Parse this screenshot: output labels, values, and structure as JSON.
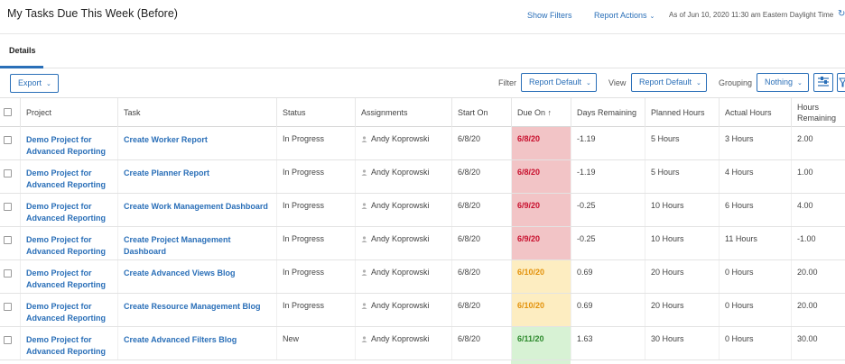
{
  "header": {
    "title": "My Tasks Due This Week (Before)",
    "show_filters": "Show Filters",
    "report_actions": "Report Actions",
    "as_of": "As of Jun 10, 2020 11:30 am Eastern Daylight Time"
  },
  "tabs": {
    "details": "Details"
  },
  "toolbar": {
    "export": "Export",
    "filter_label": "Filter",
    "filter_value": "Report Default",
    "view_label": "View",
    "view_value": "Report Default",
    "grouping_label": "Grouping",
    "grouping_value": "Nothing"
  },
  "table": {
    "columns": [
      "Project",
      "Task",
      "Status",
      "Assignments",
      "Start On",
      "Due On ↑",
      "Days Remaining",
      "Planned Hours",
      "Actual Hours",
      "Hours Remaining"
    ],
    "rows": [
      {
        "project": "Demo Project for Advanced Reporting",
        "task": "Create Worker Report",
        "status": "In Progress",
        "assignment": "Andy Koprowski",
        "start": "6/8/20",
        "due": "6/8/20",
        "due_status": "red",
        "days": "-1.19",
        "planned": "5 Hours",
        "actual": "3 Hours",
        "remaining": "2.00"
      },
      {
        "project": "Demo Project for Advanced Reporting",
        "task": "Create Planner Report",
        "status": "In Progress",
        "assignment": "Andy Koprowski",
        "start": "6/8/20",
        "due": "6/8/20",
        "due_status": "red",
        "days": "-1.19",
        "planned": "5 Hours",
        "actual": "4 Hours",
        "remaining": "1.00"
      },
      {
        "project": "Demo Project for Advanced Reporting",
        "task": "Create Work Management Dashboard",
        "status": "In Progress",
        "assignment": "Andy Koprowski",
        "start": "6/8/20",
        "due": "6/9/20",
        "due_status": "red",
        "days": "-0.25",
        "planned": "10 Hours",
        "actual": "6 Hours",
        "remaining": "4.00"
      },
      {
        "project": "Demo Project for Advanced Reporting",
        "task": "Create Project Management Dashboard",
        "status": "In Progress",
        "assignment": "Andy Koprowski",
        "start": "6/8/20",
        "due": "6/9/20",
        "due_status": "red",
        "days": "-0.25",
        "planned": "10 Hours",
        "actual": "11 Hours",
        "remaining": "-1.00"
      },
      {
        "project": "Demo Project for Advanced Reporting",
        "task": "Create Advanced Views Blog",
        "status": "In Progress",
        "assignment": "Andy Koprowski",
        "start": "6/8/20",
        "due": "6/10/20",
        "due_status": "yellow",
        "days": "0.69",
        "planned": "20 Hours",
        "actual": "0 Hours",
        "remaining": "20.00"
      },
      {
        "project": "Demo Project for Advanced Reporting",
        "task": "Create Resource Management Blog",
        "status": "In Progress",
        "assignment": "Andy Koprowski",
        "start": "6/8/20",
        "due": "6/10/20",
        "due_status": "yellow",
        "days": "0.69",
        "planned": "20 Hours",
        "actual": "0 Hours",
        "remaining": "20.00"
      },
      {
        "project": "Demo Project for Advanced Reporting",
        "task": "Create Advanced Filters Blog",
        "status": "New",
        "assignment": "Andy Koprowski",
        "start": "6/8/20",
        "due": "6/11/20",
        "due_status": "green",
        "days": "1.63",
        "planned": "30 Hours",
        "actual": "0 Hours",
        "remaining": "30.00"
      }
    ]
  },
  "colors": {
    "accent": "#2a6fb8",
    "due_red": "#f2c4c6",
    "due_yellow": "#fdedc1",
    "due_green": "#d7f2d4"
  }
}
